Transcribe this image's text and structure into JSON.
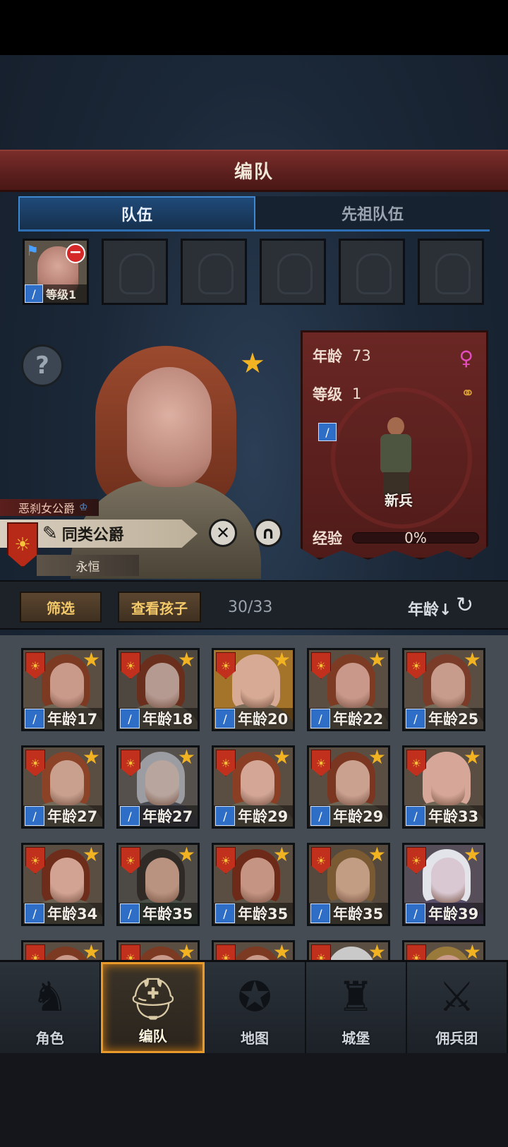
{
  "screen_title": "编队",
  "tabs": [
    {
      "label": "队伍",
      "active": true
    },
    {
      "label": "先祖队伍",
      "active": false
    }
  ],
  "party_slots": {
    "filled": {
      "level_label": "等级1",
      "icon": "sword-icon"
    },
    "empty_count": 5
  },
  "character": {
    "title_tag": "恶刹女公爵",
    "name": "同类公爵",
    "status": "永恒",
    "favorite": true
  },
  "info_panel": {
    "age_label": "年龄",
    "age_value": "73",
    "gender_icon": "female-icon",
    "level_label": "等级",
    "level_value": "1",
    "marriage_icon": "rings-icon",
    "class_name": "新兵",
    "exp_label": "经验",
    "exp_value": "0%",
    "exp_fraction": 0
  },
  "filter_bar": {
    "filter_label": "筛选",
    "children_label": "查看孩子",
    "count": "30/33",
    "sort_label": "年龄↓",
    "refresh_icon": "refresh-icon"
  },
  "roster": [
    {
      "age": "年龄17",
      "skin": "#c9998a",
      "hair": "#7c3a22",
      "fur": "#6e6555",
      "bg": "#5a4e42"
    },
    {
      "age": "年龄18",
      "skin": "#b59a92",
      "hair": "#6a2e1c",
      "fur": "#6e6555",
      "bg": "#4e4740"
    },
    {
      "age": "年龄20",
      "skin": "#d6aa94",
      "hair": "#d6aa94",
      "fur": "#7a6c58",
      "bg": "#a4742a"
    },
    {
      "age": "年龄22",
      "skin": "#c9988a",
      "hair": "#7e3b24",
      "fur": "#6e6555",
      "bg": "#5a4e42"
    },
    {
      "age": "年龄25",
      "skin": "#c89c8c",
      "hair": "#7a3c28",
      "fur": "#756b5b",
      "bg": "#5a4e42"
    },
    {
      "age": "年龄27",
      "skin": "#c9a08e",
      "hair": "#8c4226",
      "fur": "#736a5a",
      "bg": "#5a4e42"
    },
    {
      "age": "年龄27",
      "skin": "#b7a59e",
      "hair": "#9b9da2",
      "fur": "#4a4a52",
      "bg": "#55504c"
    },
    {
      "age": "年龄29",
      "skin": "#d3a696",
      "hair": "#8a3f24",
      "fur": "#6e6555",
      "bg": "#5a4e42"
    },
    {
      "age": "年龄29",
      "skin": "#caa08f",
      "hair": "#7a3620",
      "fur": "#6e6555",
      "bg": "#5a4e42"
    },
    {
      "age": "年龄33",
      "skin": "#d6a798",
      "hair": "#d6a798",
      "fur": "#6e6555",
      "bg": "#5a4e42"
    },
    {
      "age": "年龄34",
      "skin": "#d2a393",
      "hair": "#6e2c1a",
      "fur": "#6a6150",
      "bg": "#5a4e42"
    },
    {
      "age": "年龄35",
      "skin": "#b9937f",
      "hair": "#2f2a26",
      "fur": "#4a5148",
      "bg": "#4d4a45"
    },
    {
      "age": "年龄35",
      "skin": "#c69482",
      "hair": "#6e2a18",
      "fur": "#5c5446",
      "bg": "#5a4e42"
    },
    {
      "age": "年龄35",
      "skin": "#c39d83",
      "hair": "#7a5a32",
      "fur": "#5e5648",
      "bg": "#55493e"
    },
    {
      "age": "年龄39",
      "skin": "#d9c8d2",
      "hair": "#e3e3ea",
      "fur": "#5a4e6a",
      "bg": "#564e58"
    },
    {
      "age": "",
      "skin": "#c9998a",
      "hair": "#7c3a22",
      "fur": "#6e6555",
      "bg": "#5a4e42"
    },
    {
      "age": "",
      "skin": "#c9998a",
      "hair": "#7c3a22",
      "fur": "#6e6555",
      "bg": "#5a4e42"
    },
    {
      "age": "",
      "skin": "#c9998a",
      "hair": "#7c3a22",
      "fur": "#6e6555",
      "bg": "#5a4e42"
    },
    {
      "age": "",
      "skin": "#c9c9c9",
      "hair": "#c9c9c9",
      "fur": "#6e6555",
      "bg": "#5a4e42"
    },
    {
      "age": "",
      "skin": "#c9998a",
      "hair": "#9a7a3a",
      "fur": "#6e6555",
      "bg": "#5a4e42"
    }
  ],
  "bottom_nav": [
    {
      "label": "角色",
      "icon": "knight-icon",
      "active": false
    },
    {
      "label": "编队",
      "icon": "helmet-icon",
      "active": true
    },
    {
      "label": "地图",
      "icon": "compass-map-icon",
      "active": false
    },
    {
      "label": "城堡",
      "icon": "castle-icon",
      "active": false
    },
    {
      "label": "佣兵团",
      "icon": "mercenary-icon",
      "active": false
    }
  ],
  "colors": {
    "accent_gold": "#f2b323",
    "tab_blue": "#3f87cf",
    "banner_red": "#7a2d2a",
    "nav_active": "#e89b2a"
  }
}
